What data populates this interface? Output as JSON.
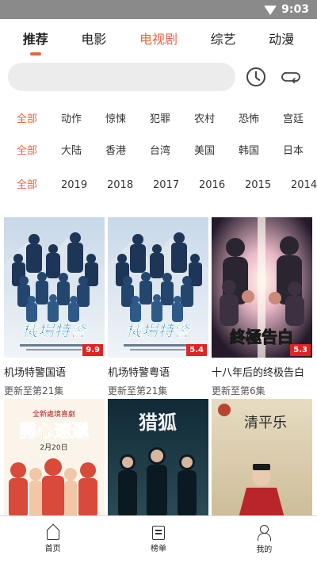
{
  "status_bar": {
    "time": "9:03"
  },
  "tabs": [
    {
      "label": "推荐"
    },
    {
      "label": "电影"
    },
    {
      "label": "电视剧"
    },
    {
      "label": "综艺"
    },
    {
      "label": "动漫"
    }
  ],
  "search": {
    "value": "",
    "placeholder": ""
  },
  "filters": {
    "genre": [
      "全部",
      "动作",
      "惊悚",
      "犯罪",
      "农村",
      "恐怖",
      "宫廷"
    ],
    "region": [
      "全部",
      "大陆",
      "香港",
      "台湾",
      "美国",
      "韩国",
      "日本"
    ],
    "year": [
      "全部",
      "2019",
      "2018",
      "2017",
      "2016",
      "2015",
      "2014"
    ]
  },
  "cards": [
    {
      "title": "机场特警国语",
      "subtitle": "更新至第21集",
      "score": "9.9"
    },
    {
      "title": "机场特警粤语",
      "subtitle": "更新至第21集",
      "score": "5.4"
    },
    {
      "title": "十八年后的终极告白",
      "subtitle": "更新至第6集",
      "score": "5.3"
    },
    {
      "title": "",
      "subtitle": "",
      "score": ""
    },
    {
      "title": "",
      "subtitle": "",
      "score": ""
    },
    {
      "title": "",
      "subtitle": "",
      "score": ""
    }
  ],
  "poster_art": {
    "card1_caption": "機場特警",
    "card4_headline": "開心速遞",
    "card4_subhead": "全新處境喜劇",
    "card4_date": "2月20日",
    "card5_title": "猎狐",
    "card6_title": "清平乐"
  },
  "bottom_nav": [
    {
      "label": "首页"
    },
    {
      "label": "榜单"
    },
    {
      "label": "我的"
    }
  ],
  "colors": {
    "accent": "#e8663e",
    "score_badge": "#e02424"
  }
}
